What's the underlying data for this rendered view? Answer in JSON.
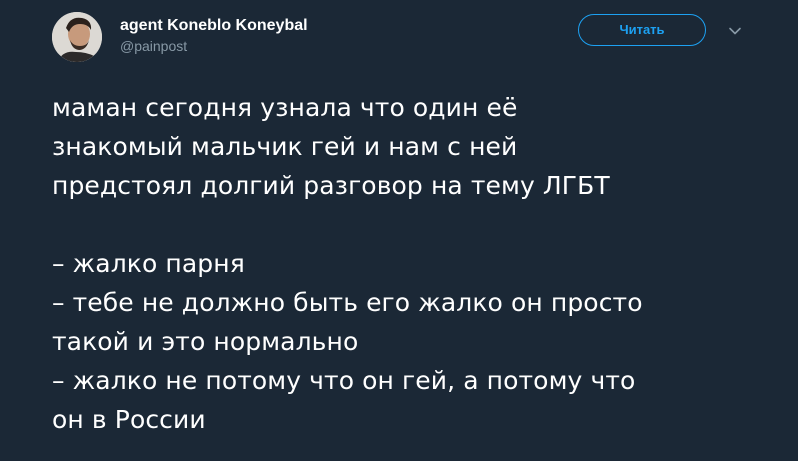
{
  "author": {
    "display_name": "agent Koneblo Koneybal",
    "handle": "@painpost",
    "avatar_icon": "user-avatar-photo"
  },
  "actions": {
    "follow_label": "Читать",
    "caret_icon": "chevron-down-icon"
  },
  "tweet": {
    "paragraph1": [
      "маман сегодня узнала что один её",
      "знакомый мальчик гей и нам с ней",
      "предстоял долгий разговор на тему ЛГБТ"
    ],
    "paragraph2": [
      "– жалко парня",
      "– тебе не должно быть его жалко он просто",
      "такой и это нормально",
      "– жалко не потому что он гей, а потому что",
      "он в России"
    ]
  },
  "colors": {
    "background": "#1b2836",
    "text": "#ffffff",
    "secondary_text": "#8899a6",
    "accent": "#1da1f2"
  }
}
